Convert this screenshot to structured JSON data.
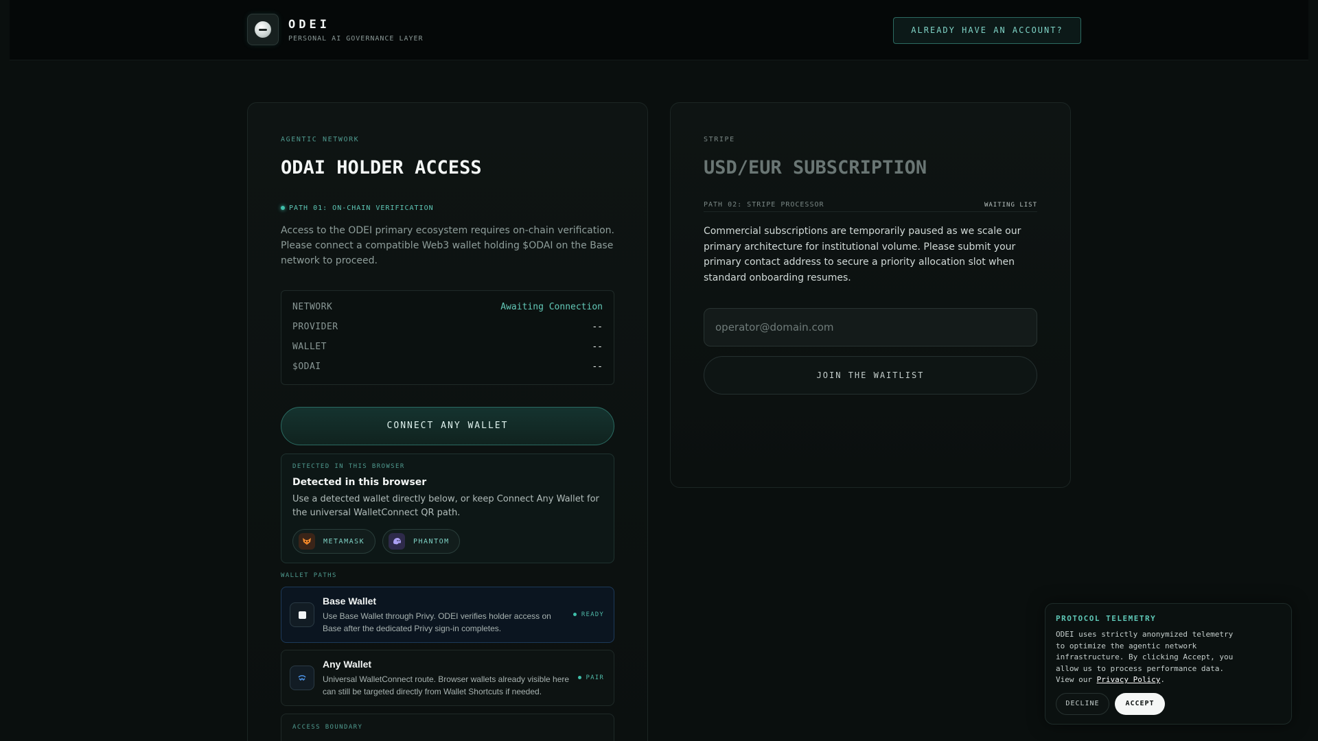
{
  "header": {
    "brand": "ODEI",
    "tagline": "PERSONAL AI GOVERNANCE LAYER",
    "login_label": "ALREADY HAVE AN ACCOUNT?"
  },
  "left_card": {
    "eyebrow": "AGENTIC NETWORK",
    "title": "ODAI HOLDER ACCESS",
    "path_label": "PATH 01: ON-CHAIN VERIFICATION",
    "description": "Access to the ODEI primary ecosystem requires on-chain verification. Please connect a compatible Web3 wallet holding $ODAI on the Base network to proceed.",
    "status": [
      {
        "key": "NETWORK",
        "value": "Awaiting Connection"
      },
      {
        "key": "PROVIDER",
        "value": "--"
      },
      {
        "key": "WALLET",
        "value": "--"
      },
      {
        "key": "$ODAI",
        "value": "--"
      }
    ],
    "connect_label": "CONNECT ANY WALLET",
    "detected": {
      "eyebrow": "DETECTED IN THIS BROWSER",
      "title": "Detected in this browser",
      "text": "Use a detected wallet directly below, or keep Connect Any Wallet for the universal WalletConnect QR path.",
      "chips": [
        {
          "label": "METAMASK",
          "icon": "metamask-fox-icon"
        },
        {
          "label": "PHANTOM",
          "icon": "phantom-ghost-icon"
        }
      ]
    },
    "wallet_paths_label": "WALLET PATHS",
    "wallets": [
      {
        "name": "Base Wallet",
        "desc": "Use Base Wallet through Privy. ODEI verifies holder access on Base after the dedicated Privy sign-in completes.",
        "status": "READY",
        "icon": "base-square-icon"
      },
      {
        "name": "Any Wallet",
        "desc": "Universal WalletConnect route. Browser wallets already visible here can still be targeted directly from Wallet Shortcuts if needed.",
        "status": "PAIR",
        "icon": "walletconnect-icon"
      }
    ],
    "boundary_label": "ACCESS BOUNDARY"
  },
  "right_card": {
    "eyebrow": "STRIPE",
    "title": "USD/EUR SUBSCRIPTION",
    "path_label": "PATH 02: STRIPE PROCESSOR",
    "badge": "WAITING LIST",
    "description": "Commercial subscriptions are temporarily paused as we scale our primary architecture for institutional volume. Please submit your primary contact address to secure a priority allocation slot when standard onboarding resumes.",
    "email_placeholder": "operator@domain.com",
    "waitlist_label": "JOIN THE WAITLIST"
  },
  "telemetry": {
    "title": "PROTOCOL TELEMETRY",
    "text": "ODEI uses strictly anonymized telemetry to optimize the agentic network infrastructure. By clicking Accept, you allow us to process performance data. View our ",
    "link": "Privacy Policy",
    "after_link": ".",
    "decline_label": "DECLINE",
    "accept_label": "ACCEPT"
  },
  "colors": {
    "background": "#0a0f0e",
    "accent": "#5ec7b6",
    "base_blue": "#0b1520"
  }
}
